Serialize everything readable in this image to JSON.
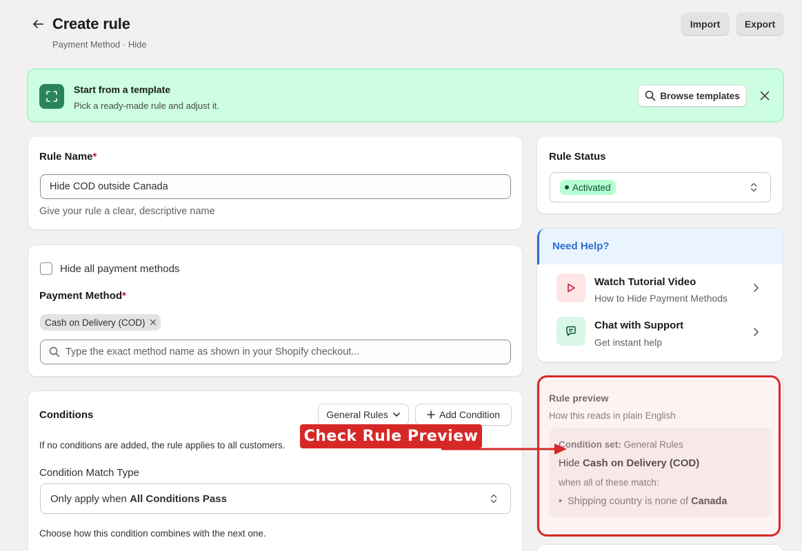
{
  "header": {
    "title": "Create rule",
    "subtitle": "Payment Method · Hide",
    "import_label": "Import",
    "export_label": "Export"
  },
  "banner": {
    "title": "Start from a template",
    "subtitle": "Pick a ready-made rule and adjust it.",
    "browse_label": "Browse templates"
  },
  "rule_name": {
    "label": "Rule Name",
    "required": "*",
    "value": "Hide COD outside Canada",
    "help": "Give your rule a clear, descriptive name"
  },
  "payment": {
    "hide_all_label": "Hide all payment methods",
    "hide_all_checked": false,
    "label": "Payment Method",
    "required": "*",
    "tags": [
      "Cash on Delivery (COD)"
    ],
    "search_placeholder": "Type the exact method name as shown in your Shopify checkout..."
  },
  "conditions": {
    "title": "Conditions",
    "general_rules_label": "General Rules",
    "add_condition_label": "Add Condition",
    "note": "If no conditions are added, the rule applies to all customers.",
    "match_type_label": "Condition Match Type",
    "match_prefix": "Only apply when ",
    "match_value": "All Conditions Pass",
    "combine_help": "Choose how this condition combines with the next one."
  },
  "status": {
    "label": "Rule Status",
    "value": "Activated"
  },
  "help": {
    "title": "Need Help?",
    "items": [
      {
        "title": "Watch Tutorial Video",
        "subtitle": "How to Hide Payment Methods"
      },
      {
        "title": "Chat with Support",
        "subtitle": "Get instant help"
      }
    ]
  },
  "preview": {
    "title": "Rule preview",
    "subtitle": "How this reads in plain English",
    "condition_set_label": "Condition set:",
    "condition_set_value": "General Rules",
    "hide_prefix": "Hide ",
    "hide_value": "Cash on Delivery (COD)",
    "when_text": "when all of these match:",
    "bullet_prefix": "Shipping country is none of ",
    "bullet_value": "Canada"
  },
  "annotation": {
    "callout": "Check Rule Preview",
    "color": "#d72828"
  }
}
